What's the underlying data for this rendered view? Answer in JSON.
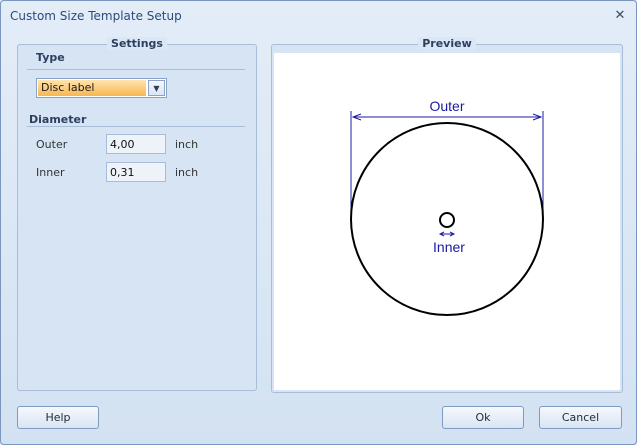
{
  "window": {
    "title": "Custom Size Template Setup"
  },
  "settings": {
    "legend": "Settings",
    "type_heading": "Type",
    "type_value": "Disc label",
    "diameter_heading": "Diameter",
    "outer": {
      "label": "Outer",
      "value": "4,00",
      "unit": "inch"
    },
    "inner": {
      "label": "Inner",
      "value": "0,31",
      "unit": "inch"
    }
  },
  "preview": {
    "legend": "Preview",
    "outer_label": "Outer",
    "inner_label": "Inner",
    "line_color": "#1c1ca0"
  },
  "buttons": {
    "help": "Help",
    "ok": "Ok",
    "cancel": "Cancel"
  }
}
